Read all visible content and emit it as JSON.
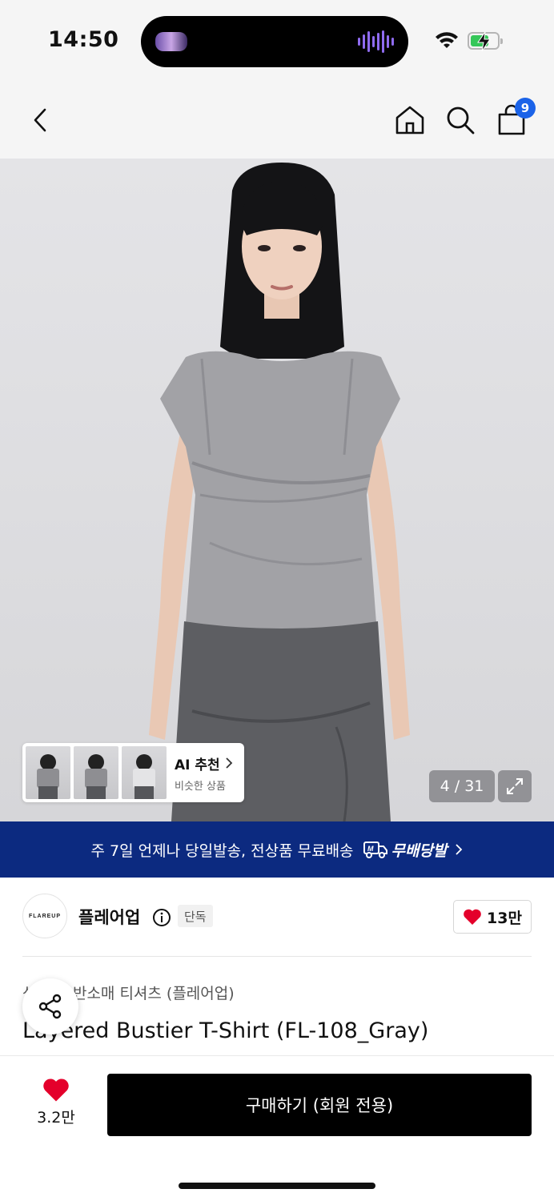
{
  "status_bar": {
    "time": "14:50"
  },
  "header": {
    "cart_count": "9"
  },
  "hero": {
    "image_counter": "4 / 31",
    "ai_recommend": {
      "title": "AI 추천",
      "subtitle": "비슷한 상품"
    }
  },
  "banner": {
    "text": "주 7일 언제나 당일발송, 전상품 무료배송",
    "brand_label": "무배당발",
    "badge_letter": "M"
  },
  "brand": {
    "logo_text": "FLAREUP",
    "name": "플레어업",
    "exclusive_tag": "단독",
    "likes": "13만"
  },
  "product": {
    "category": "상의 > 반소매 티셔츠 (플레어업)",
    "title": "Layered Bustier T-Shirt (FL-108_Gray)"
  },
  "bottom_bar": {
    "wish_count": "3.2만",
    "buy_label": "구매하기 (회원 전용)"
  },
  "colors": {
    "banner_bg": "#0c2a80",
    "badge_blue": "#1b63e8",
    "heart_red": "#e4002b",
    "buy_bg": "#000000"
  },
  "icons": [
    "back-icon",
    "home-icon",
    "search-icon",
    "shopping-bag-icon",
    "expand-icon",
    "share-icon",
    "heart-icon",
    "info-icon",
    "chevron-right-icon"
  ]
}
